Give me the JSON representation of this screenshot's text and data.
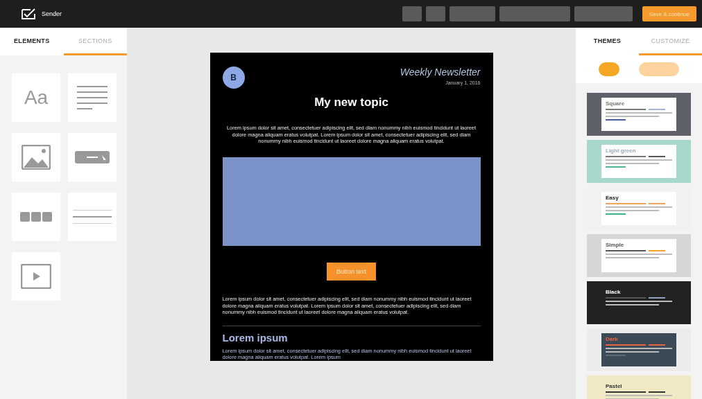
{
  "app": {
    "name": "Sender",
    "save_button": "Save & continue"
  },
  "left_tabs": [
    {
      "label": "ELEMENTS",
      "selected": true
    },
    {
      "label": "SECTIONS",
      "selected": false
    }
  ],
  "elements": [
    {
      "kind": "text",
      "label": "Aa"
    },
    {
      "kind": "paragraph"
    },
    {
      "kind": "image"
    },
    {
      "kind": "button"
    },
    {
      "kind": "social"
    },
    {
      "kind": "divider"
    },
    {
      "kind": "video"
    }
  ],
  "email": {
    "logo": "B",
    "title": "Weekly Newsletter",
    "date": "January 1, 2016",
    "heading": "My new topic",
    "intro": "Lorem ipsum dolor sit amet, consectetuer adipiscing elit, sed diam nonummy nibh euismod tincidunt ut laoreet dolore magna aliquam eratus volutpat. Lorem ipsum dolor sit amet, consectetuer adipiscing elit, sed diam nonummy nibh euismod tincidunt ut laoreet dolore magna aliquam eratus volutpat.",
    "button": "Button text",
    "body": "Lorem ipsum dolor sit amet, consectetuer adipiscing elit, sed diam nonummy nibh euismod tincidunt ut laoreet dolore magna aliquam eratus volutpat. Lorem ipsum dolor sit amet, consectetuer adipiscing elit, sed diam nonummy nibh euismod tincidunt ut laoreet dolore magna aliquam eratus volutpat.",
    "subheading": "Lorem ipsum",
    "footer": "Lorem ipsum dolor sit amet, consectetuer adipiscing elit, sed diam nonummy nibh euismod tincidunt ut laoreet dolore magna aliquam eratus volutpat. Lorem ipsum"
  },
  "right_tabs": [
    {
      "label": "THEMES",
      "selected": true
    },
    {
      "label": "CUSTOMIZE",
      "selected": false
    }
  ],
  "toggles": [
    {
      "selected": true
    },
    {
      "selected": false
    }
  ],
  "themes": [
    {
      "name": "Square",
      "color": "#5d6068"
    },
    {
      "name": "Light green",
      "color": "#a8d8cc"
    },
    {
      "name": "Easy",
      "color": "#f1f1f1"
    },
    {
      "name": "Simple",
      "color": "#d6d6d6"
    },
    {
      "name": "Black",
      "color": "#222222"
    },
    {
      "name": "Dark",
      "color": "#ececec"
    },
    {
      "name": "Pastel",
      "color": "#f1e8c4"
    }
  ]
}
